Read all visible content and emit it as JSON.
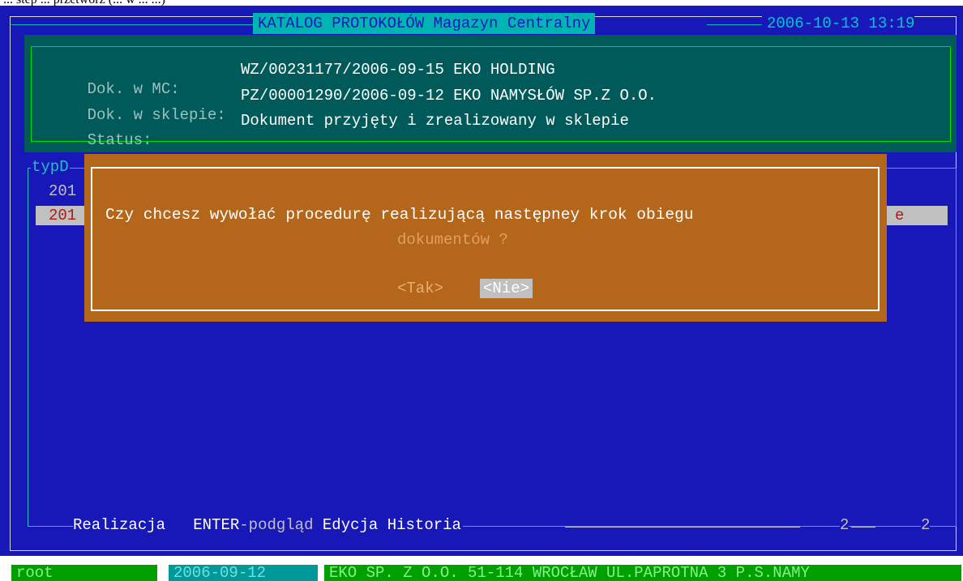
{
  "caption": "... step ... przetwórz (... w ... ...)",
  "header": {
    "title": "KATALOG PROTOKOŁÓW Magazyn Centralny",
    "datetime": "2006-10-13 13:19"
  },
  "info": {
    "rows": [
      {
        "label": "Dok. w MC:",
        "value": "WZ/00231177/2006-09-15 EKO HOLDING"
      },
      {
        "label": "Dok. w sklepie:",
        "value": "PZ/00001290/2006-09-12 EKO NAMYSŁÓW SP.Z O.O."
      },
      {
        "label": "Status:",
        "value": "Dokument przyjęty i zrealizowany w sklepie"
      }
    ]
  },
  "list": {
    "title": "typD",
    "rows": [
      {
        "left": "201",
        "right": ""
      },
      {
        "left": "201",
        "right": "e"
      }
    ]
  },
  "dialog": {
    "message_line1": "Czy chcesz wywołać procedurę realizującą następney krok obiegu",
    "message_line2": "dokumentów ?",
    "yes_label": "<Tak>",
    "no_label": "<Nie>"
  },
  "footer": {
    "items": [
      "Realizacja",
      "ENTER",
      "-podgląd",
      "Edycja",
      "Historia"
    ],
    "page_current": "2",
    "page_total": "2"
  },
  "statusbar": {
    "user": "root",
    "date": "2006-09-12",
    "company": "EKO SP. Z O.O. 51-114 WROCŁAW UL.PAPROTNA 3 P.S.NAMY"
  },
  "colors": {
    "screen_bg": "#1818b8",
    "info_bg": "#005a5a",
    "dialog_bg": "#b4661a",
    "title_bg": "#00b4b4"
  }
}
